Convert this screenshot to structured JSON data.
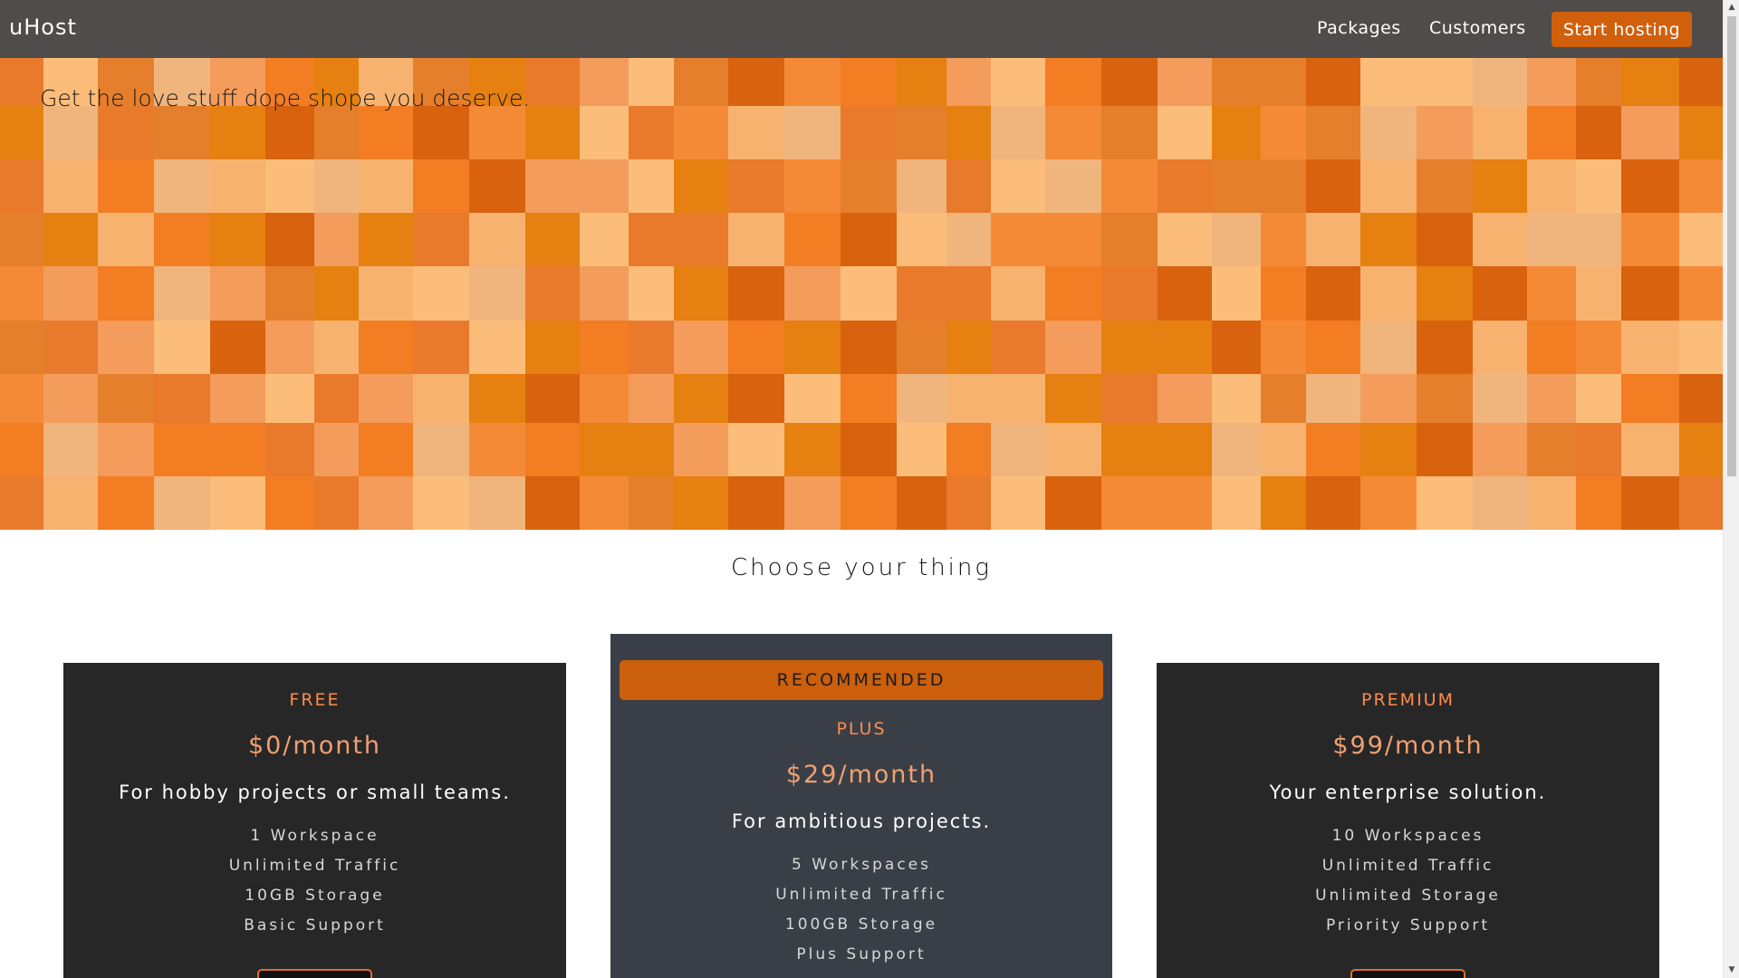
{
  "header": {
    "brand": "uHost",
    "nav": {
      "packages": "Packages",
      "customers": "Customers"
    },
    "cta_label": "Start hosting"
  },
  "hero": {
    "tagline": "Get the love stuff dope shope you deserve."
  },
  "section_title": "Choose your thing",
  "plans": {
    "free": {
      "name": "FREE",
      "price": "$0/month",
      "description": "For hobby projects or small teams.",
      "features": [
        "1 Workspace",
        "Unlimited Traffic",
        "10GB Storage",
        "Basic Support"
      ]
    },
    "plus": {
      "badge": "RECOMMENDED",
      "name": "PLUS",
      "price": "$29/month",
      "description": "For ambitious projects.",
      "features": [
        "5 Workspaces",
        "Unlimited Traffic",
        "100GB Storage",
        "Plus Support"
      ]
    },
    "premium": {
      "name": "PREMIUM",
      "price": "$99/month",
      "description": "Your enterprise solution.",
      "features": [
        "10 Workspaces",
        "Unlimited Traffic",
        "Unlimited Storage",
        "Priority Support"
      ]
    }
  },
  "colors": {
    "header_bg": "#4f4c4b",
    "accent": "#d1600c",
    "plan_dark_bg": "#272727",
    "plan_recommended_bg": "#3a3f47",
    "plan_name": "#ff8c4a",
    "hero_palette": [
      "#d9620e",
      "#e97a2c",
      "#f58a36",
      "#f39c5b",
      "#f7b26f",
      "#fbbd79",
      "#e57f2c",
      "#f27d22",
      "#e68010",
      "#efb57c"
    ]
  },
  "icons": {
    "scroll_up": "triangle-up-icon",
    "scroll_down": "triangle-down-icon"
  }
}
